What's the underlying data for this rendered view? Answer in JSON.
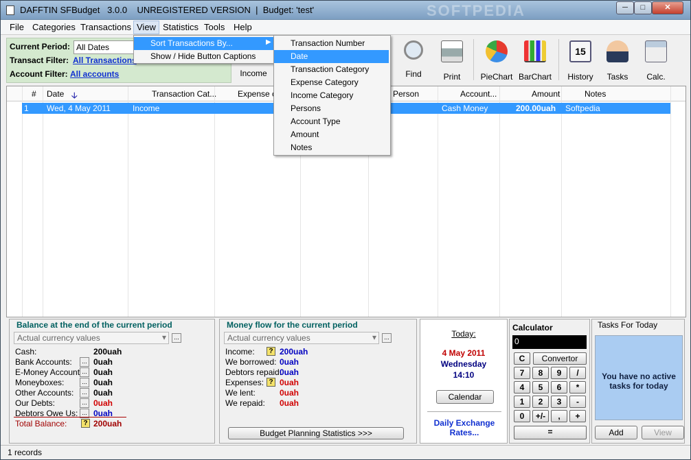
{
  "window": {
    "title": "DAFFTIN SFBudget   3.0.0    UNREGISTERED VERSION  |  Budget: 'test'",
    "min": "─",
    "max": "□",
    "close": "✕",
    "watermark": "SOFTPEDIA"
  },
  "menubar": [
    "File",
    "Categories",
    "Transactions",
    "View",
    "Statistics",
    "Tools",
    "Help"
  ],
  "filters": {
    "period_label": "Current Period:",
    "period_value": "All Dates",
    "transact_label": "Transact Filter:",
    "transact_value": "All Transactions",
    "account_label": "Account Filter:",
    "account_value": "All accounts"
  },
  "toolbar": [
    "Income",
    "Find",
    "Print",
    "PieChart",
    "BarChart",
    "History",
    "Tasks",
    "Calc."
  ],
  "view_menu": {
    "sort": "Sort Transactions By...",
    "toggle": "Show / Hide Button Captions",
    "sort_icon": "sort-az-icon"
  },
  "sort_submenu": [
    "Transaction Number",
    "Date",
    "Transaction Category",
    "Expense Category",
    "Income Category",
    "Persons",
    "Account Type",
    "Amount",
    "Notes"
  ],
  "grid": {
    "headers": [
      "#",
      "Date",
      "Transaction Cat...",
      "Expense ca",
      "Person",
      "Account...",
      "Amount",
      "Notes"
    ],
    "sort_arrow": "🡣",
    "rows": [
      {
        "num": "1",
        "date": "Wed, 4 May 2011",
        "tcat": "Income",
        "account": "Cash Money",
        "amount": "200.00uah",
        "notes": "Softpedia"
      }
    ]
  },
  "balance": {
    "title": "Balance at the end of the current period",
    "combo": "Actual currency values",
    "dots": "...",
    "rows": [
      {
        "label": "Cash:",
        "value": "200uah",
        "color": "#000"
      },
      {
        "label": "Bank Accounts:",
        "value": "0uah",
        "color": "#000"
      },
      {
        "label": "E-Money Accounts:",
        "value": "0uah",
        "color": "#000"
      },
      {
        "label": "Moneyboxes:",
        "value": "0uah",
        "color": "#000"
      },
      {
        "label": "Other Accounts:",
        "value": "0uah",
        "color": "#000"
      },
      {
        "label": "Our Debts:",
        "value": "0uah",
        "color": "#d00000"
      },
      {
        "label": "Debtors Owe Us:",
        "value": "0uah",
        "color": "#0000c0"
      }
    ],
    "total_label": "Total Balance:",
    "total_value": "200uah"
  },
  "moneyflow": {
    "title": "Money flow for the current period",
    "combo": "Actual currency values",
    "dots": "...",
    "rows": [
      {
        "label": "Income:",
        "value": "200uah",
        "color": "#0000c0"
      },
      {
        "label": "We borrowed:",
        "value": "0uah",
        "color": "#0000c0"
      },
      {
        "label": "Debtors repaid:",
        "value": "0uah",
        "color": "#0000c0"
      },
      {
        "label": "Expenses:",
        "value": "0uah",
        "color": "#d00000"
      },
      {
        "label": "We lent:",
        "value": "0uah",
        "color": "#d00000"
      },
      {
        "label": "We repaid:",
        "value": "0uah",
        "color": "#d00000"
      }
    ],
    "button": "Budget Planning Statistics >>>"
  },
  "today": {
    "label": "Today:",
    "date": "4 May 2011",
    "day": "Wednesday",
    "time": "14:10",
    "button": "Calendar",
    "rates": "Daily Exchange Rates..."
  },
  "calculator": {
    "title": "Calculator",
    "display": "0",
    "clear": "C",
    "convertor": "Convertor",
    "keys": [
      [
        "7",
        "8",
        "9",
        "/"
      ],
      [
        "4",
        "5",
        "6",
        "*"
      ],
      [
        "1",
        "2",
        "3",
        "-"
      ],
      [
        "0",
        "+/-",
        ",",
        "+"
      ]
    ],
    "equals": "="
  },
  "tasks": {
    "title": "Tasks For Today",
    "message": "You have no active tasks for today",
    "add": "Add",
    "view": "View"
  },
  "status": "1 records"
}
